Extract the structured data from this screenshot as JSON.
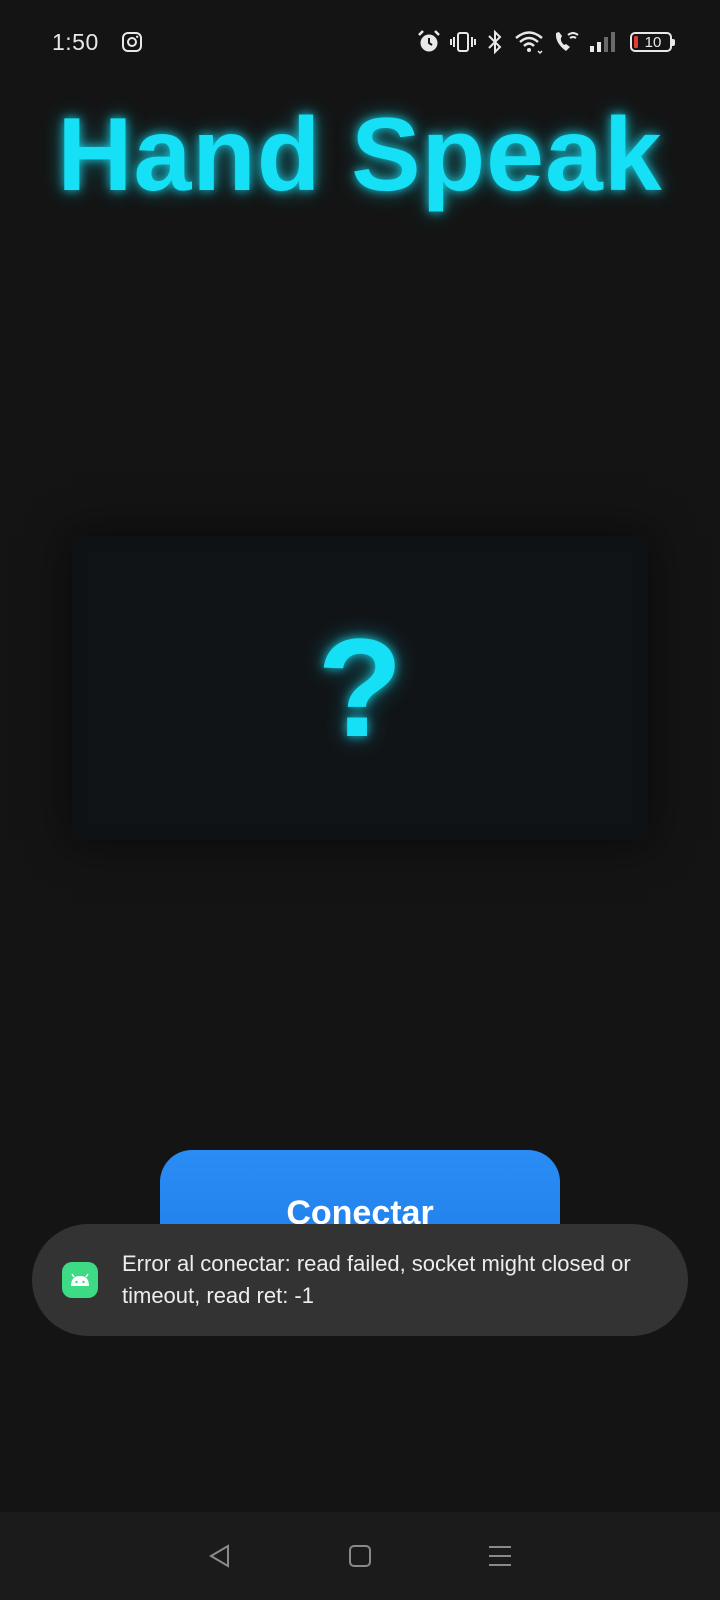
{
  "status_bar": {
    "time": "1:50",
    "battery_level": "10",
    "icons": [
      "instagram-icon",
      "alarm-icon",
      "vibrate-icon",
      "bluetooth-icon",
      "wifi-icon",
      "wifi-calling-icon",
      "signal-icon",
      "battery-icon"
    ]
  },
  "app": {
    "title": "Hand Speak",
    "display_text": "?",
    "connect_label": "Conectar"
  },
  "toast": {
    "message": "Error al conectar: read failed, socket might closed or timeout, read ret: -1",
    "icon": "android-icon"
  },
  "nav": {
    "back_icon": "back-triangle-icon",
    "home_icon": "home-square-icon",
    "recents_icon": "menu-lines-icon"
  },
  "colors": {
    "background": "#141414",
    "accent": "#16e0f5",
    "button": "#2a8cf5",
    "toast_bg": "#333333"
  }
}
